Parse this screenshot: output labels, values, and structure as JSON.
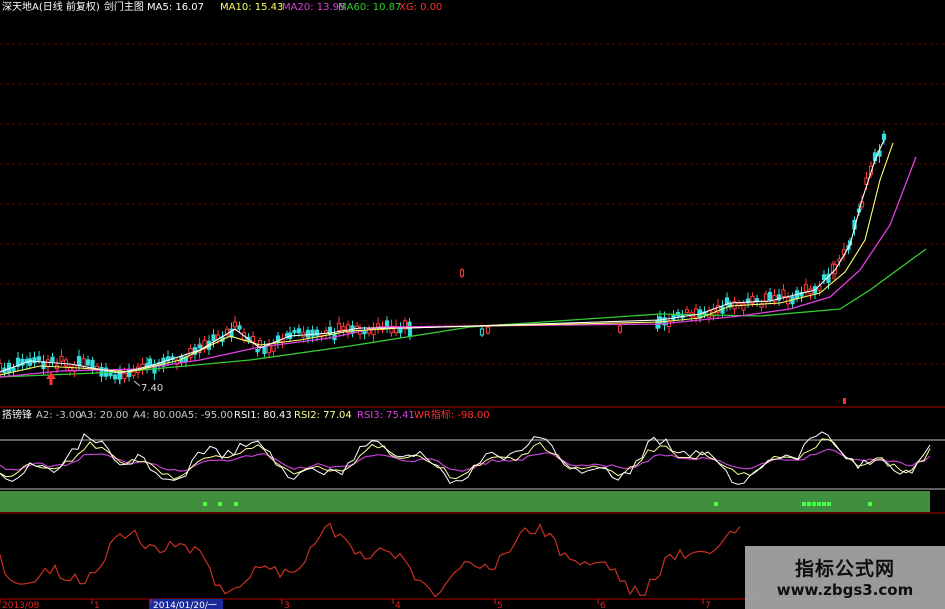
{
  "header": {
    "stock_name": "深天地A",
    "period": "(日线 前复权)",
    "indicator_name": "剑门主图",
    "ma": [
      {
        "label": "MA5:",
        "value": "16.07",
        "color": "#ffffff"
      },
      {
        "label": "MA10:",
        "value": "15.43",
        "color": "#ffff66"
      },
      {
        "label": "MA20:",
        "value": "13.95",
        "color": "#e040e0"
      },
      {
        "label": "MA60:",
        "value": "10.87",
        "color": "#33cc33"
      },
      {
        "label": "XG:",
        "value": "0.00",
        "color": "#ff3030"
      }
    ]
  },
  "main_panel": {
    "low_price_label": "7.40"
  },
  "indicator_header": {
    "name": "搭镑锋",
    "items": [
      {
        "label": "A2:",
        "value": "-3.00",
        "color": "#c8c8c8"
      },
      {
        "label": "A3:",
        "value": "20.00",
        "color": "#c8c8c8"
      },
      {
        "label": "A4:",
        "value": "80.00",
        "color": "#c8c8c8"
      },
      {
        "label": "A5:",
        "value": "-95.00",
        "color": "#c8c8c8"
      },
      {
        "label": "RSI1:",
        "value": "80.43",
        "color": "#ffffff"
      },
      {
        "label": "RSI2:",
        "value": "77.04",
        "color": "#ffff99"
      },
      {
        "label": "RSI3:",
        "value": "75.41",
        "color": "#e040e0"
      },
      {
        "label": "WR指标:",
        "value": "-98.00",
        "color": "#ff3030"
      }
    ]
  },
  "time_axis": {
    "labels": [
      "2013/08",
      "1",
      "2014/01/20/一",
      "3",
      "4",
      "5",
      "6",
      "7"
    ]
  },
  "watermark": {
    "title": "指标公式网",
    "url": "www.zbgs3.com"
  },
  "chart_data": {
    "type": "line",
    "title": "深天地A (日线 前复权) 剑门主图",
    "main_series": [
      {
        "name": "MA5",
        "values": [
          16.07
        ]
      },
      {
        "name": "MA10",
        "values": [
          15.43
        ]
      },
      {
        "name": "MA20",
        "values": [
          13.95
        ]
      },
      {
        "name": "MA60",
        "values": [
          10.87
        ]
      },
      {
        "name": "XG",
        "values": [
          0.0
        ]
      }
    ],
    "indicator_series": [
      {
        "name": "RSI1",
        "values": [
          80.43
        ]
      },
      {
        "name": "RSI2",
        "values": [
          77.04
        ]
      },
      {
        "name": "RSI3",
        "values": [
          75.41
        ]
      },
      {
        "name": "WR",
        "values": [
          -98.0
        ]
      }
    ],
    "annotations": [
      "7.40"
    ]
  }
}
